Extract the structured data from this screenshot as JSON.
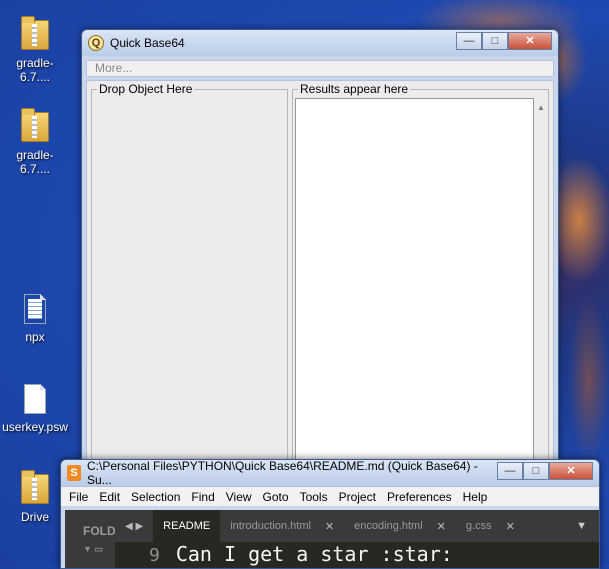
{
  "desktop": {
    "icons": [
      {
        "label": "gradle-6.7....",
        "icon": "folder-zip-icon"
      },
      {
        "label": "gradle-6.7....",
        "icon": "folder-zip-icon"
      },
      {
        "label": "npx",
        "icon": "text-file-icon"
      },
      {
        "label": "userkey.psw",
        "icon": "document-icon"
      },
      {
        "label": "Drive",
        "icon": "folder-icon"
      }
    ]
  },
  "quick_base64": {
    "title": "Quick Base64",
    "app_icon_glyph": "Q",
    "menu_more": "More...",
    "drop_label": "Drop Object Here",
    "results_label": "Results appear here",
    "minimize": "—",
    "maximize": "□",
    "close": "✕"
  },
  "sublime": {
    "title": "C:\\Personal Files\\PYTHON\\Quick Base64\\README.md (Quick Base64) - Su...",
    "menu": [
      "File",
      "Edit",
      "Selection",
      "Find",
      "View",
      "Goto",
      "Tools",
      "Project",
      "Preferences",
      "Help"
    ],
    "sidebar_label": "FOLD",
    "tabs": [
      {
        "label": "README",
        "active": true
      },
      {
        "label": "introduction.html",
        "active": false
      },
      {
        "label": "encoding.html",
        "active": false
      },
      {
        "label": "g.css",
        "active": false
      }
    ],
    "editor_line_number": "9",
    "editor_line_text": "Can I get a star :star:"
  }
}
